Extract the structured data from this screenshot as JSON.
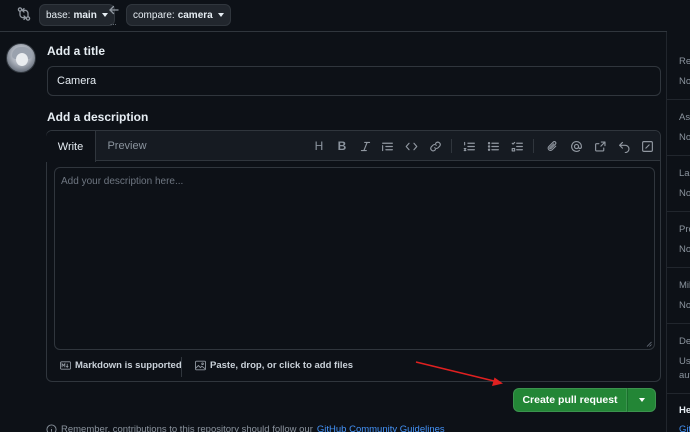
{
  "compare": {
    "base_label": "base:",
    "base_value": "main",
    "compare_label": "compare:",
    "compare_value": "camera",
    "dots": "..."
  },
  "form": {
    "title_heading": "Add a title",
    "title_value": "Camera",
    "description_heading": "Add a description",
    "description_placeholder": "Add your description here..."
  },
  "editor": {
    "tabs": [
      "Write",
      "Preview"
    ],
    "toolbar": [
      "heading",
      "bold",
      "italic",
      "quote",
      "code",
      "link",
      "numbered-list",
      "unordered-list",
      "task-list",
      "attach",
      "mention",
      "reference",
      "undo",
      "fullscreen"
    ],
    "markdown_note": "Markdown is supported",
    "attach_note": "Paste, drop, or click to add files"
  },
  "actions": {
    "create_label": "Create pull request"
  },
  "notice": {
    "prefix": "Remember, contributions to this repository should follow our",
    "link": "GitHub Community Guidelines"
  },
  "sidebar": {
    "items": [
      {
        "head": "Re",
        "val": "No"
      },
      {
        "head": "Ass",
        "val": "No"
      },
      {
        "head": "Lab",
        "val": "No"
      },
      {
        "head": "Pro",
        "val": "No"
      },
      {
        "head": "Mil",
        "val": "No"
      },
      {
        "head": "De",
        "val": "Use",
        "val2": "aut"
      },
      {
        "head": "He",
        "val": "Git"
      }
    ]
  },
  "colors": {
    "background": "#0d1117",
    "accent_green": "#238636",
    "link_blue": "#4493f8",
    "annotation_red": "#e02020"
  }
}
